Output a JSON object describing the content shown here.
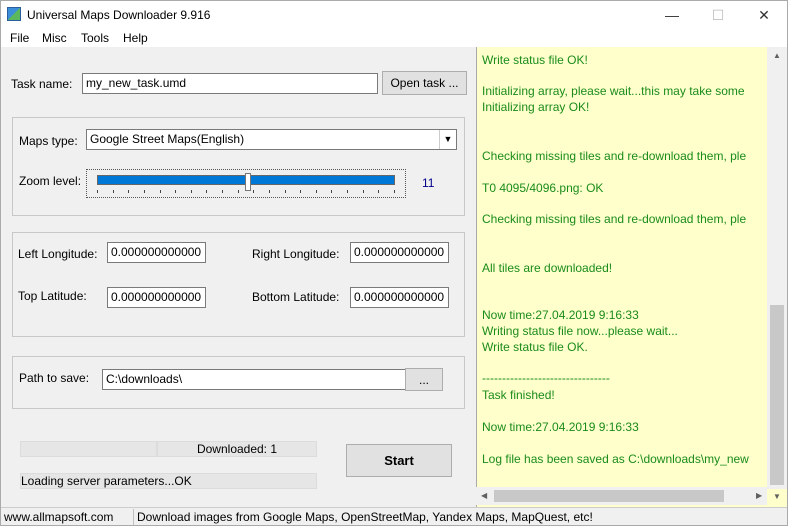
{
  "window": {
    "title": "Universal Maps Downloader 9.916",
    "minimize": "—",
    "maximize": "☐",
    "close": "✕"
  },
  "menu": [
    "File",
    "Misc",
    "Tools",
    "Help"
  ],
  "task": {
    "label": "Task name:",
    "value": "my_new_task.umd",
    "open_button": "Open task ..."
  },
  "maps": {
    "type_label": "Maps type:",
    "type_value": "Google Street Maps(English)",
    "zoom_label": "Zoom level:",
    "zoom_value": "11"
  },
  "coords": {
    "left_lon_label": "Left Longitude:",
    "left_lon_value": "0.000000000000",
    "right_lon_label": "Right Longitude:",
    "right_lon_value": "0.000000000000",
    "top_lat_label": "Top Latitude:",
    "top_lat_value": "0.000000000000",
    "bottom_lat_label": "Bottom Latitude:",
    "bottom_lat_value": "0.000000000000"
  },
  "path": {
    "label": "Path to save:",
    "value": "C:\\downloads\\",
    "browse_button": "..."
  },
  "progress": {
    "downloaded": "Downloaded: 1",
    "status": "Loading server parameters...OK",
    "start_button": "Start"
  },
  "log": [
    "Write status file OK!",
    "Initializing array, please wait...this may take some",
    "Initializing array OK!",
    "Checking missing tiles and re-download them, ple",
    "T0 4095/4096.png: OK",
    "Checking missing tiles and re-download them, ple",
    "All tiles are downloaded!",
    "Now time:27.04.2019 9:16:33",
    "Writing status file now...please wait...",
    "Write status file OK.",
    "--------------------------------",
    "Task finished!",
    "Now time:27.04.2019 9:16:33",
    "Log file has been saved as C:\\downloads\\my_new"
  ],
  "statusbar": {
    "website": "www.allmapsoft.com",
    "message": "Download images from Google Maps, OpenStreetMap, Yandex Maps, MapQuest, etc!"
  }
}
